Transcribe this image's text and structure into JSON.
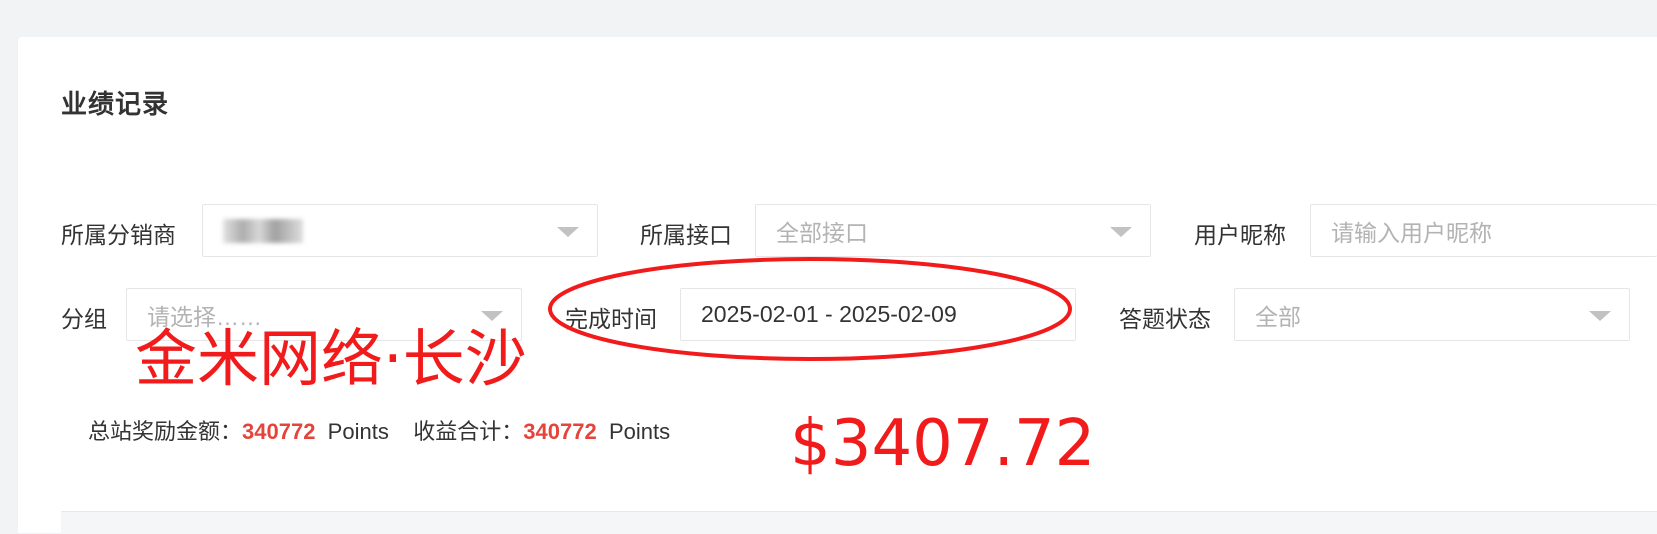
{
  "page": {
    "title": "业绩记录"
  },
  "filters": {
    "distributor": {
      "label": "所属分销商",
      "value_redacted": true
    },
    "interface": {
      "label": "所属接口",
      "placeholder": "全部接口"
    },
    "nickname": {
      "label": "用户昵称",
      "placeholder": "请输入用户昵称"
    },
    "group": {
      "label": "分组",
      "placeholder": "请选择……"
    },
    "completion_time": {
      "label": "完成时间",
      "value": "2025-02-01 - 2025-02-09"
    },
    "answer_status": {
      "label": "答题状态",
      "placeholder": "全部"
    }
  },
  "summary": {
    "total_reward_label": "总站奖励金额：",
    "total_reward_value": "340772",
    "total_reward_unit": "Points",
    "income_total_label": "收益合计：",
    "income_total_value": "340772",
    "income_total_unit": "Points"
  },
  "annotations": {
    "brand_text": "金米网络·长沙",
    "amount_text": "$3407.72",
    "color": "#f11b1b"
  },
  "colors": {
    "accent_number": "#e5443b",
    "background": "#f2f3f5",
    "card": "#ffffff"
  }
}
